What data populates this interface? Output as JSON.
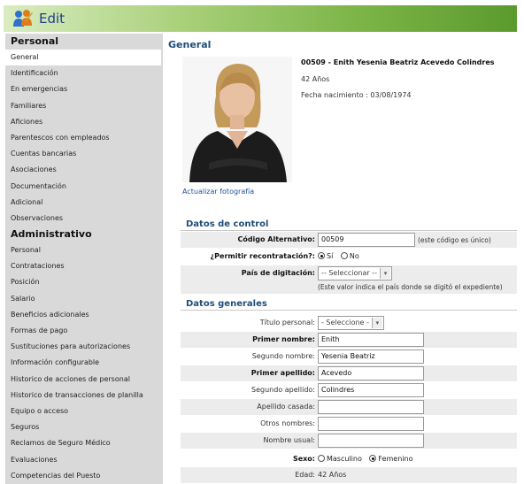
{
  "window": {
    "title": "Edit"
  },
  "sidebar": {
    "sections": [
      {
        "title": "Personal",
        "items": [
          "General",
          "Identificación",
          "En emergencias",
          "Familiares",
          "Aficiones",
          "Parentescos con empleados",
          "Cuentas bancarias",
          "Asociaciones",
          "Documentación",
          "Adicional",
          "Observaciones"
        ]
      },
      {
        "title": "Administrativo",
        "items": [
          "Personal",
          "Contrataciones",
          "Posición",
          "Salario",
          "Beneficios adicionales",
          "Formas de pago",
          "Sustituciones para autorizaciones",
          "Información configurable",
          "Historico de acciones de personal",
          "Historico de transacciones de planilla",
          "Equipo o acceso",
          "Seguros",
          "Reclamos de Seguro Médico",
          "Evaluaciones",
          "Competencias del Puesto"
        ]
      }
    ],
    "active_item": "General"
  },
  "main": {
    "section_title": "General",
    "employee": {
      "name": "00509 - Enith Yesenia Beatriz Acevedo Colindres",
      "age": "42 Años",
      "birth": "Fecha nacimiento : 03/08/1974"
    },
    "photo_link": "Actualizar fotografía",
    "control": {
      "title": "Datos de control",
      "alt_code_label": "Código Alternativo:",
      "alt_code_value": "00509",
      "alt_code_note": "(este código es único)",
      "rehire_label": "¿Permitir recontratación?:",
      "rehire_yes": "Sí",
      "rehire_no": "No",
      "country_label": "País de digitación:",
      "country_value": "-- Seleccionar --",
      "country_note": "(Este valor indica el país donde se digitó el expediente)"
    },
    "general": {
      "title": "Datos generales",
      "title_label": "Título personal:",
      "title_value": "- Seleccione -",
      "first_name_label": "Primer nombre:",
      "first_name_value": "Enith",
      "second_name_label": "Segundo nombre:",
      "second_name_value": "Yesenia Beatriz",
      "first_last_label": "Primer apellido:",
      "first_last_value": "Acevedo",
      "second_last_label": "Segundo apellido:",
      "second_last_value": "Colindres",
      "married_label": "Apellido casada:",
      "married_value": "",
      "other_names_label": "Otros nombres:",
      "other_names_value": "",
      "usual_name_label": "Nombre usual:",
      "usual_name_value": "",
      "sex_label": "Sexo:",
      "sex_male": "Masculino",
      "sex_female": "Femenino",
      "age_label": "Edad:",
      "age_value": "42 Años"
    }
  },
  "colors": {
    "title_bar": "#7bb447",
    "section_title": "#1f4e79",
    "link": "#1f4e9a",
    "sidebar_bg": "#d9d9d9"
  }
}
